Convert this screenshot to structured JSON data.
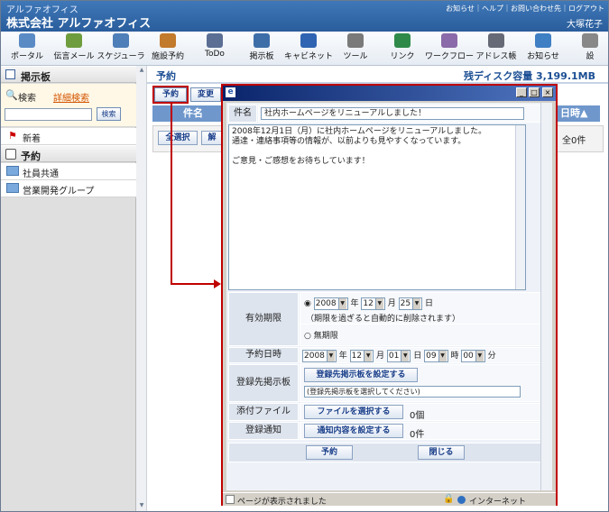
{
  "header": {
    "app": "アルファオフィス",
    "company": "株式会社 アルファオフィス",
    "links": "お知らせ｜ヘルプ｜お問い合わせ先｜ログアウト",
    "user": "大塚花子"
  },
  "toolbar": [
    {
      "label": "ポータル",
      "icon": "portal-icon",
      "color": "#5a8bc5"
    },
    {
      "label": "伝言メール",
      "icon": "message-mail-icon",
      "color": "#6f9d3e"
    },
    {
      "label": "スケジューラ",
      "icon": "scheduler-icon",
      "color": "#4f7fb8"
    },
    {
      "label": "施設予約",
      "icon": "facility-icon",
      "color": "#c27a2c"
    },
    {
      "label": "ToDo",
      "icon": "todo-icon",
      "color": "#5b6f94"
    },
    {
      "label": "掲示板",
      "icon": "board-icon",
      "color": "#3e6ea8"
    },
    {
      "label": "キャビネット",
      "icon": "cabinet-icon",
      "color": "#2f64b2"
    },
    {
      "label": "ツール",
      "icon": "tool-icon",
      "color": "#7a7a7a"
    },
    {
      "label": "リンク",
      "icon": "link-icon",
      "color": "#2f8a4a"
    },
    {
      "label": "ワークフロー",
      "icon": "workflow-icon",
      "color": "#8a6aa8"
    },
    {
      "label": "アドレス帳",
      "icon": "address-book-icon",
      "color": "#666a76"
    },
    {
      "label": "お知らせ",
      "icon": "notice-icon",
      "color": "#3f7fc4"
    },
    {
      "label": "設",
      "icon": "settings-icon",
      "color": "#888888"
    }
  ],
  "sidebar": {
    "title": "掲示板",
    "search": "検索",
    "detail_search": "詳細検索",
    "search_btn": "検索",
    "new": "新着",
    "reserve": "予約",
    "groups": [
      "社員共通",
      "営業開発グループ"
    ]
  },
  "main": {
    "title": "予約",
    "disk": "残ディスク容量 3,199.1MB",
    "tabs": [
      "予約",
      "変更"
    ],
    "col_subject": "件名",
    "col_date": "日時▲",
    "select_all": "全選択",
    "release": "解",
    "count": "全0件"
  },
  "popup": {
    "subject_label": "件名",
    "subject_value": "社内ホームページをリニューアルしました！",
    "body": [
      "2008年12月1日（月）に社内ホームページをリニューアルしました。",
      "通達・連絡事項等の情報が、以前よりも見やすくなっています。",
      "",
      "ご意見・ご感想をお待ちしています！"
    ],
    "expiry_label": "有効期限",
    "expiry": {
      "year": "2008",
      "y": "年",
      "month": "12",
      "m": "月",
      "day": "25",
      "d": "日"
    },
    "expiry_note": "（期限を過ぎると自動的に削除されます）",
    "unlimited": "無期限",
    "reserve_label": "予約日時",
    "reserve": {
      "year": "2008",
      "y": "年",
      "month": "12",
      "m": "月",
      "day": "01",
      "d": "日",
      "hour": "09",
      "h": "時",
      "min": "00",
      "mi": "分"
    },
    "board_label": "登録先掲示板",
    "board_btn": "登録先掲示板を設定する",
    "board_note": "(登録先掲示板を選択してください)",
    "attach_label": "添付ファイル",
    "attach_btn": "ファイルを選択する",
    "attach_count": "0個",
    "notify_label": "登録通知",
    "notify_btn": "通知内容を設定する",
    "notify_count": "0件",
    "submit": "予約",
    "close": "閉じる",
    "status": "ページが表示されました",
    "zone": "インターネット"
  },
  "colors": {
    "highlight": "#c00000",
    "header": "#2a5d9c"
  }
}
